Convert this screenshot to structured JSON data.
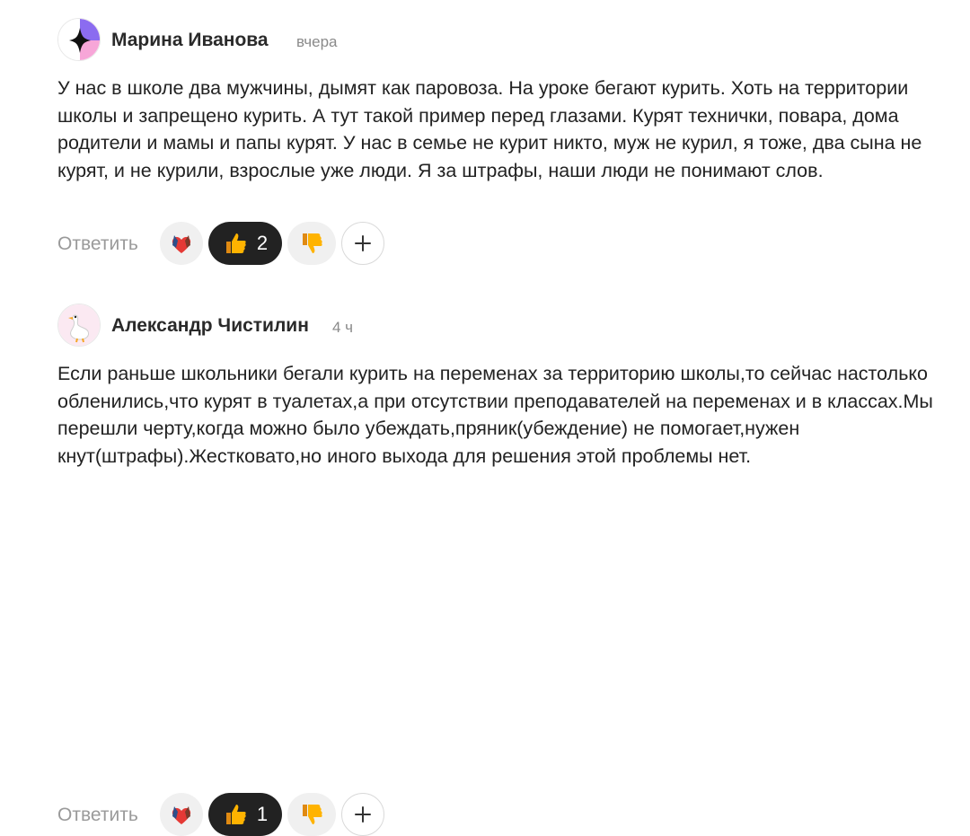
{
  "comments": [
    {
      "author": "Марина Иванова",
      "time": "вчера",
      "avatar_icon": "sparkle-avatar-icon",
      "text": "У нас в школе два мужчины, дымят как паровоза. На уроке бегают курить. Хоть на территории школы и запрещено курить. А тут такой пример перед глазами. Курят технички, повара, дома родители и мамы и папы курят. У нас в семье не курит никто, муж не курил, я тоже, два сына не курят, и не курили, взрослые уже люди. Я за штрафы, наши люди не понимают слов.",
      "reply_label": "Ответить",
      "like_count": "2"
    },
    {
      "author": "Александр Чистилин",
      "time": "4 ч",
      "avatar_icon": "goose-avatar-icon",
      "text": "Если раньше школьники бегали курить на переменах за территорию школы,то сейчас настолько обленились,что курят в туалетах,а при отсутствии преподавателей на переменах и в классах.Мы перешли черту,когда можно было убеждать,пряник(убеждение) не помогает,нужен кнут(штрафы).Жестковато,но иного выхода для решения этой проблемы нет.",
      "reply_label": "Ответить",
      "like_count": "1"
    }
  ],
  "colors": {
    "like_pill_bg": "#222222",
    "reaction_bg": "#f0f0f0",
    "muted_text": "#9a9a9a"
  }
}
